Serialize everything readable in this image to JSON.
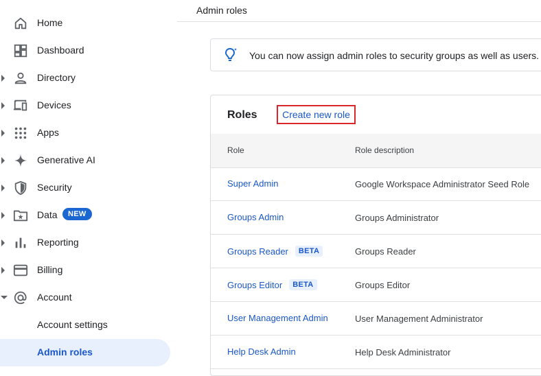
{
  "sidebar": {
    "items": [
      {
        "label": "Home",
        "icon": "home-icon"
      },
      {
        "label": "Dashboard",
        "icon": "dashboard-icon"
      },
      {
        "label": "Directory",
        "icon": "person-icon"
      },
      {
        "label": "Devices",
        "icon": "devices-icon"
      },
      {
        "label": "Apps",
        "icon": "apps-grid-icon"
      },
      {
        "label": "Generative AI",
        "icon": "sparkle-icon"
      },
      {
        "label": "Security",
        "icon": "shield-icon"
      },
      {
        "label": "Data",
        "icon": "folder-star-icon",
        "badge": "NEW"
      },
      {
        "label": "Reporting",
        "icon": "bar-chart-icon"
      },
      {
        "label": "Billing",
        "icon": "credit-card-icon"
      },
      {
        "label": "Account",
        "icon": "at-sign-icon"
      }
    ],
    "subitems": [
      {
        "label": "Account settings"
      },
      {
        "label": "Admin roles",
        "active": true
      }
    ]
  },
  "header": {
    "title": "Admin roles"
  },
  "banner": {
    "text": "You can now assign admin roles to security groups as well as users.",
    "icon": "lightbulb-icon"
  },
  "roles": {
    "title": "Roles",
    "create_label": "Create new role",
    "columns": [
      "Role",
      "Role description"
    ],
    "rows": [
      {
        "name": "Super Admin",
        "desc": "Google Workspace Administrator Seed Role"
      },
      {
        "name": "Groups Admin",
        "desc": "Groups Administrator"
      },
      {
        "name": "Groups Reader",
        "badge": "BETA",
        "desc": "Groups Reader"
      },
      {
        "name": "Groups Editor",
        "badge": "BETA",
        "desc": "Groups Editor"
      },
      {
        "name": "User Management Admin",
        "desc": "User Management Administrator"
      },
      {
        "name": "Help Desk Admin",
        "desc": "Help Desk Administrator"
      }
    ]
  },
  "colors": {
    "accent": "#1a57c7",
    "active_bg": "#e8f0fe",
    "highlight_border": "#d9262c"
  }
}
